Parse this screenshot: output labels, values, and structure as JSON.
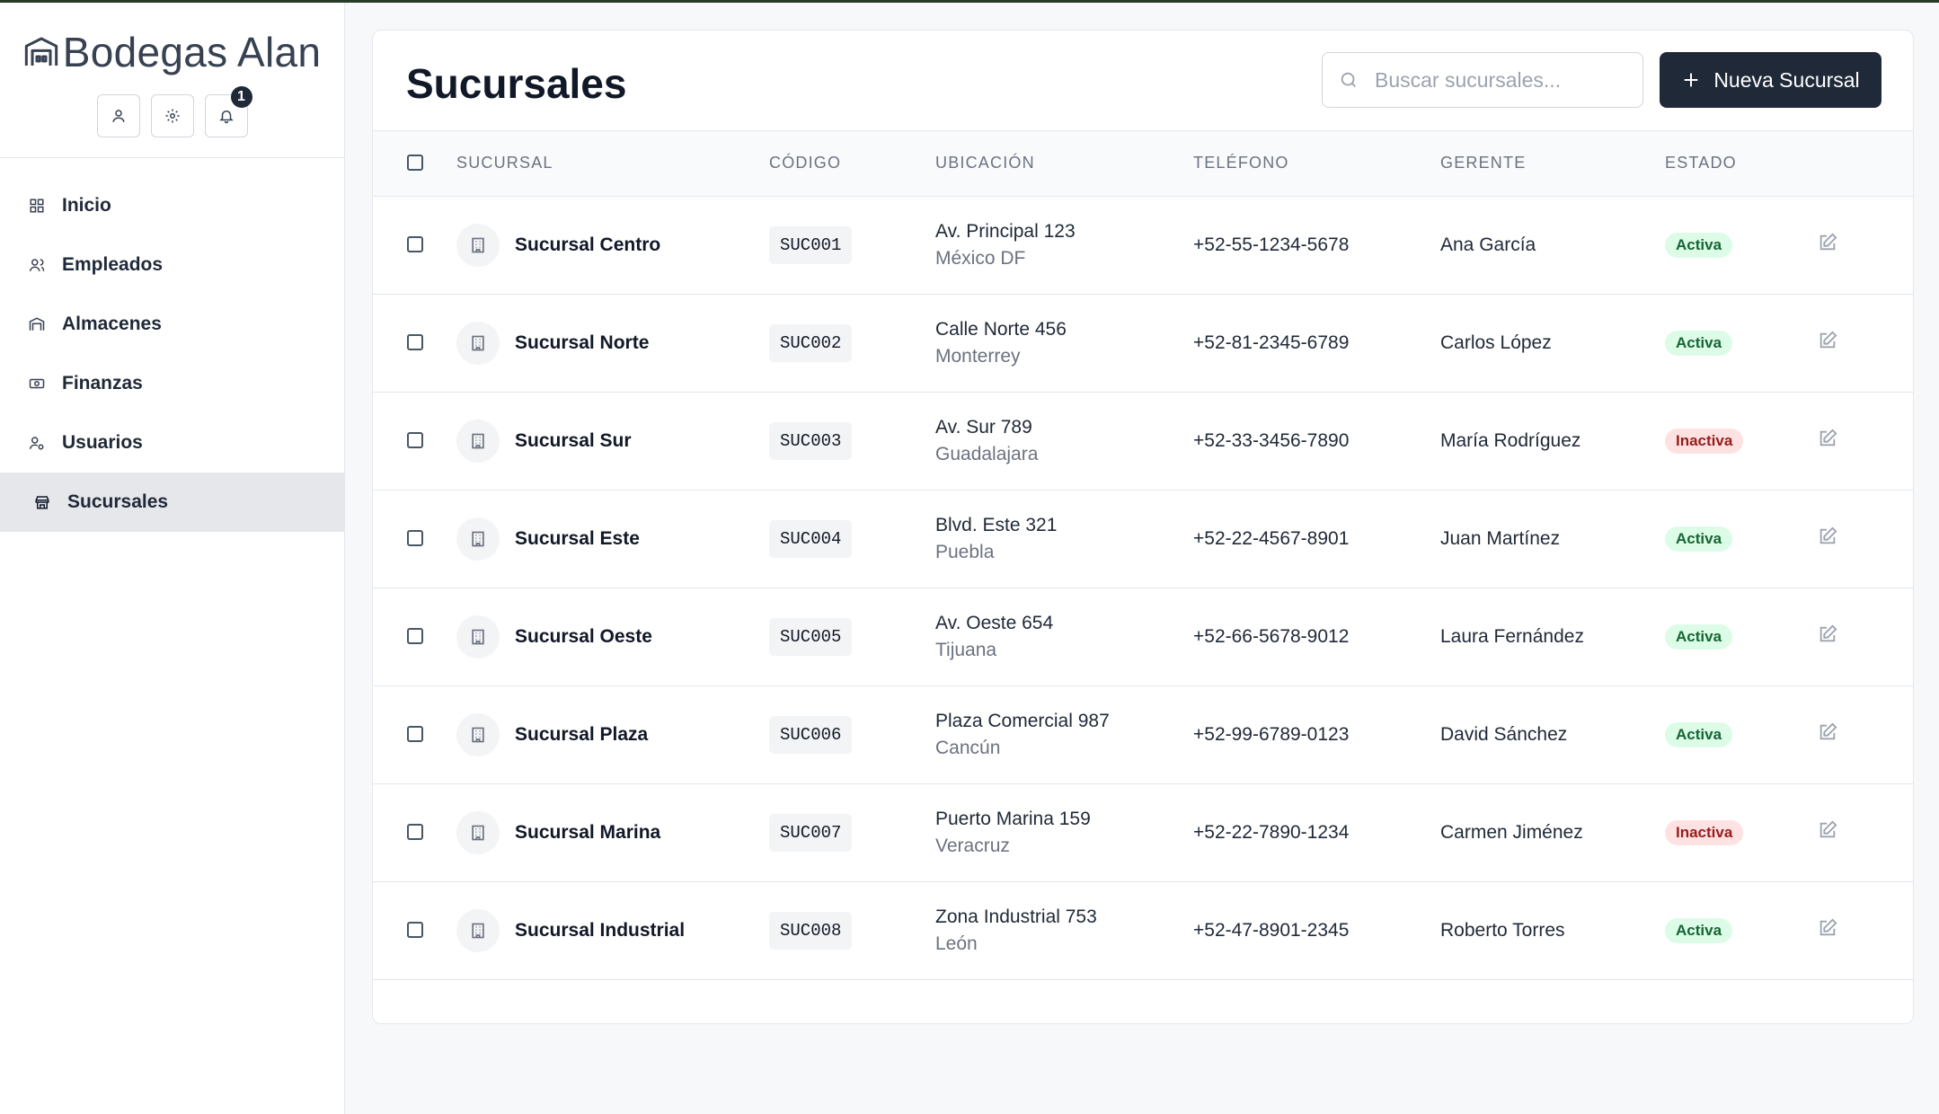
{
  "brand": {
    "name": "Bodegas Alan",
    "notifications": "1"
  },
  "nav": [
    {
      "label": "Inicio",
      "name": "inicio"
    },
    {
      "label": "Empleados",
      "name": "empleados"
    },
    {
      "label": "Almacenes",
      "name": "almacenes"
    },
    {
      "label": "Finanzas",
      "name": "finanzas"
    },
    {
      "label": "Usuarios",
      "name": "usuarios"
    },
    {
      "label": "Sucursales",
      "name": "sucursales",
      "active": true
    }
  ],
  "page": {
    "title": "Sucursales",
    "search_placeholder": "Buscar sucursales...",
    "new_button": "Nueva Sucursal"
  },
  "table": {
    "headers": [
      "SUCURSAL",
      "CÓDIGO",
      "UBICACIÓN",
      "TELÉFONO",
      "GERENTE",
      "ESTADO"
    ],
    "rows": [
      {
        "name": "Sucursal Centro",
        "code": "SUC001",
        "address": "Av. Principal 123",
        "city": "México DF",
        "phone": "+52-55-1234-5678",
        "manager": "Ana García",
        "status": "Activa"
      },
      {
        "name": "Sucursal Norte",
        "code": "SUC002",
        "address": "Calle Norte 456",
        "city": "Monterrey",
        "phone": "+52-81-2345-6789",
        "manager": "Carlos López",
        "status": "Activa"
      },
      {
        "name": "Sucursal Sur",
        "code": "SUC003",
        "address": "Av. Sur 789",
        "city": "Guadalajara",
        "phone": "+52-33-3456-7890",
        "manager": "María Rodríguez",
        "status": "Inactiva"
      },
      {
        "name": "Sucursal Este",
        "code": "SUC004",
        "address": "Blvd. Este 321",
        "city": "Puebla",
        "phone": "+52-22-4567-8901",
        "manager": "Juan Martínez",
        "status": "Activa"
      },
      {
        "name": "Sucursal Oeste",
        "code": "SUC005",
        "address": "Av. Oeste 654",
        "city": "Tijuana",
        "phone": "+52-66-5678-9012",
        "manager": "Laura Fernández",
        "status": "Activa"
      },
      {
        "name": "Sucursal Plaza",
        "code": "SUC006",
        "address": "Plaza Comercial 987",
        "city": "Cancún",
        "phone": "+52-99-6789-0123",
        "manager": "David Sánchez",
        "status": "Activa"
      },
      {
        "name": "Sucursal Marina",
        "code": "SUC007",
        "address": "Puerto Marina 159",
        "city": "Veracruz",
        "phone": "+52-22-7890-1234",
        "manager": "Carmen Jiménez",
        "status": "Inactiva"
      },
      {
        "name": "Sucursal Industrial",
        "code": "SUC008",
        "address": "Zona Industrial 753",
        "city": "León",
        "phone": "+52-47-8901-2345",
        "manager": "Roberto Torres",
        "status": "Activa"
      }
    ]
  },
  "colors": {
    "primary": "#1f2937",
    "active_bg": "#dcfce7",
    "active_text": "#166534",
    "inactive_bg": "#fee2e2",
    "inactive_text": "#991b1b"
  }
}
